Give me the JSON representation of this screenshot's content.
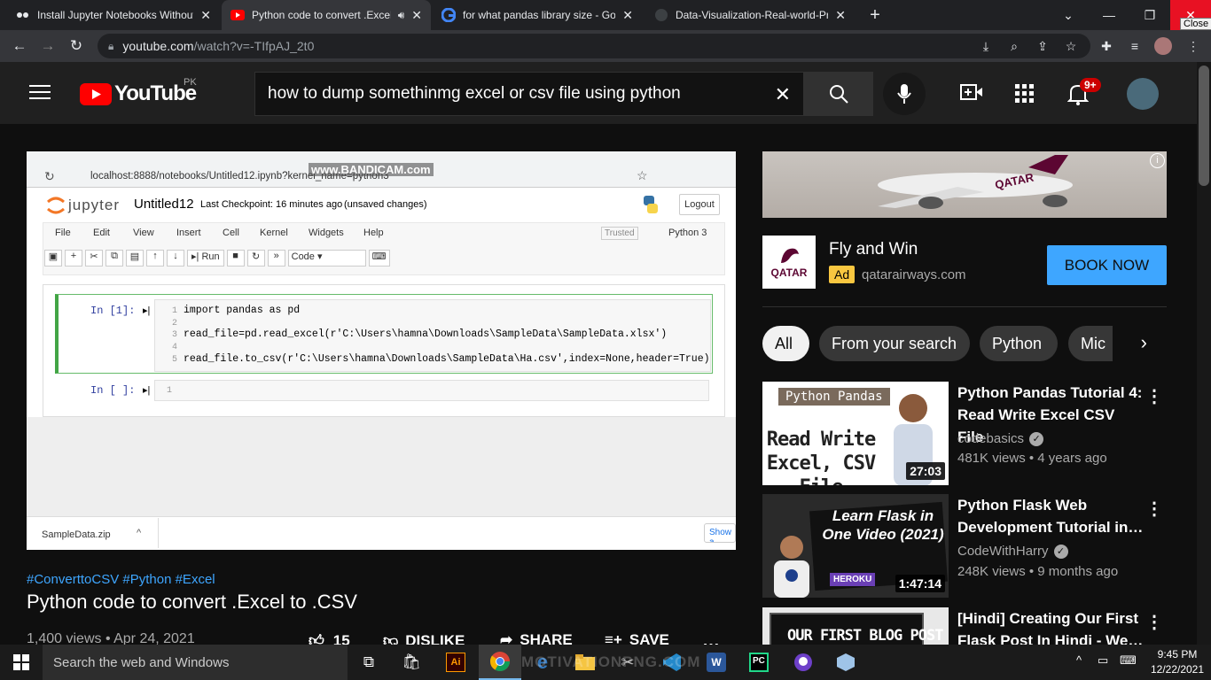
{
  "browser": {
    "tabs": [
      {
        "title": "Install Jupyter Notebooks Without"
      },
      {
        "title": "Python code to convert .Excel"
      },
      {
        "title": "for what pandas library size - Goo"
      },
      {
        "title": "Data-Visualization-Real-world-Pr"
      }
    ],
    "close_tooltip": "Close",
    "url_host": "youtube.com",
    "url_path": "/watch?v=-TIfpAJ_2t0"
  },
  "youtube": {
    "logo_text": "YouTube",
    "region": "PK",
    "search_value": "how to dump somethinmg excel or csv file using python",
    "notification_count": "9+"
  },
  "video_frame": {
    "watermark": "www.BANDICAM.com",
    "url": "localhost:8888/notebooks/Untitled12.ipynb?kernel_name=python3",
    "jupyter_logo": "jupyter",
    "notebook_name": "Untitled12",
    "checkpoint": "Last Checkpoint: 16 minutes ago",
    "unsaved": "(unsaved changes)",
    "logout": "Logout",
    "menu": [
      "File",
      "Edit",
      "View",
      "Insert",
      "Cell",
      "Kernel",
      "Widgets",
      "Help"
    ],
    "trusted": "Trusted",
    "kernel": "Python 3",
    "run": "Run",
    "cell_type": "Code",
    "cell1_prompt": "In [1]:",
    "cell2_prompt": "In [ ]:",
    "line_numbers": [
      "1",
      "2",
      "3",
      "4",
      "5"
    ],
    "code_line1": "import pandas as pd",
    "code_line3": "read_file=pd.read_excel(r'C:\\Users\\hamna\\Downloads\\SampleData\\SampleData.xlsx')",
    "code_line5": "read_file.to_csv(r'C:\\Users\\hamna\\Downloads\\SampleData\\Ha.csv',index=None,header=True)",
    "cell2_line": "1",
    "download_file": "SampleData.zip",
    "show_all": "Show a"
  },
  "video_info": {
    "hashtags": "#ConverttoCSV #Python #Excel",
    "title": "Python code to convert .Excel to .CSV",
    "views_date": "1,400 views • Apr 24, 2021",
    "likes": "15",
    "dislike": "DISLIKE",
    "share": "SHARE",
    "save": "SAVE"
  },
  "ad": {
    "title": "Fly and Win",
    "badge": "Ad",
    "domain": "qatarairways.com",
    "cta": "BOOK NOW",
    "logo_text": "QATAR",
    "plane_text": "QATAR"
  },
  "chips": [
    "All",
    "From your search",
    "Python",
    "Mic"
  ],
  "recommendations": [
    {
      "title": "Python Pandas Tutorial 4: Read Write Excel CSV File",
      "channel": "codebasics",
      "meta": "481K views • 4 years ago",
      "duration": "27:03",
      "thumb_tag": "Python Pandas",
      "thumb_text": "Read Write Excel, CSV File"
    },
    {
      "title": "Python Flask Web Development Tutorial in…",
      "channel": "CodeWithHarry",
      "meta": "248K views • 9 months ago",
      "duration": "1:47:14",
      "thumb_text": "Learn Flask in One Video (2021)",
      "thumb_badge": "HEROKU"
    },
    {
      "title": "[Hindi] Creating Our First Flask Post In Hindi - We…",
      "thumb_text": "OUR FIRST BLOG POST"
    }
  ],
  "taskbar": {
    "search_placeholder": "Search the web and Windows",
    "watermark": "MOTIVATIONPNG.COM",
    "time": "9:45 PM",
    "date": "12/22/2021"
  },
  "colors": {
    "youtube_red": "#ff0000",
    "link_blue": "#3ea6ff",
    "book_btn": "#3ea6ff",
    "jupyter_orange": "#f37726"
  }
}
